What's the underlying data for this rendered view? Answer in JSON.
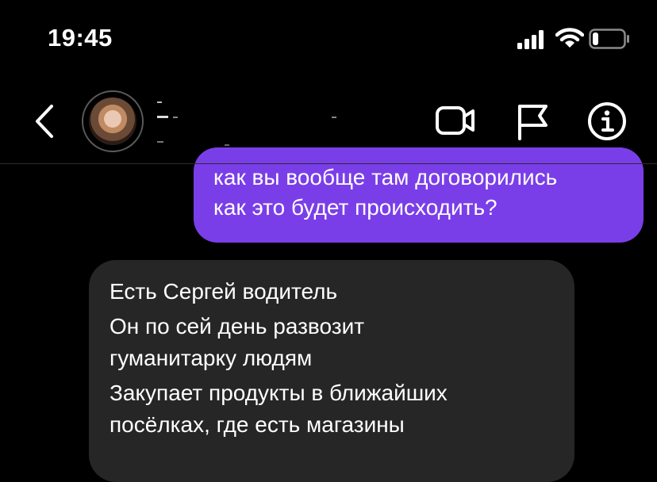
{
  "status_bar": {
    "time": "19:45",
    "icons": [
      "cellular-signal-icon",
      "wifi-icon",
      "battery-icon"
    ],
    "battery_level": 0.2
  },
  "header": {
    "back_icon": "chevron-left-icon",
    "avatar": "avatar",
    "actions": [
      "video-call-icon",
      "flag-icon",
      "info-icon"
    ]
  },
  "messages": [
    {
      "direction": "outgoing",
      "color": "#7a3ee9",
      "lines": [
        "как вы вообще там договорились",
        "как это будет происходить?"
      ]
    },
    {
      "direction": "incoming",
      "color": "#262626",
      "lines": [
        "Есть Сергей водитель",
        "Он по сей день развозит",
        "гуманитарку людям",
        "Закупает продукты в ближайших",
        "посёлках, где есть магазины"
      ]
    }
  ],
  "colors": {
    "background": "#000000",
    "outgoing_bubble": "#7a3ee9",
    "incoming_bubble": "#262626",
    "text": "#ffffff"
  }
}
